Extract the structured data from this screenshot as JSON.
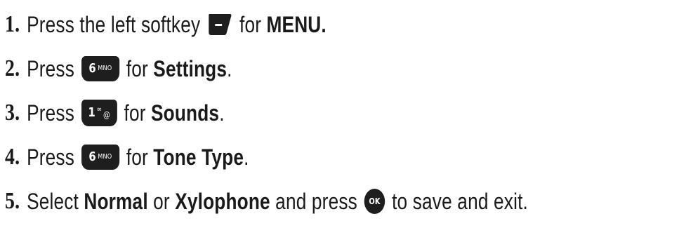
{
  "steps": [
    {
      "number": "1.",
      "before": "Press the left softkey",
      "icon": "left-softkey-icon",
      "after": "for",
      "bold": "MENU.",
      "end": ""
    },
    {
      "number": "2.",
      "before": "Press",
      "icon": "six-mno-key-icon",
      "key_digit": "6",
      "key_letters": "MNO",
      "after": "for",
      "bold": "Settings",
      "end": "."
    },
    {
      "number": "3.",
      "before": "Press",
      "icon": "one-voicemail-key-icon",
      "key_digit": "1",
      "key_letters": "∞",
      "key_extra": "@",
      "after": "for",
      "bold": "Sounds",
      "end": "."
    },
    {
      "number": "4.",
      "before": "Press",
      "icon": "six-mno-key-icon",
      "key_digit": "6",
      "key_letters": "MNO",
      "after": "for",
      "bold": "Tone Type",
      "end": "."
    },
    {
      "number": "5.",
      "before": "Select",
      "bold1": "Normal",
      "mid": "or",
      "bold2": "Xylophone",
      "after": "and press",
      "icon": "ok-key-icon",
      "key_label": "OK",
      "end": "to save and exit."
    }
  ]
}
